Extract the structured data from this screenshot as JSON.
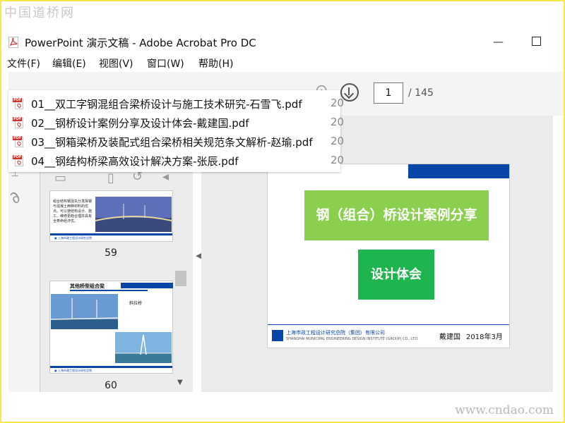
{
  "watermark": {
    "top": "中国道桥网",
    "bottom": "www.cndao.com"
  },
  "window": {
    "title": "PowerPoint 演示文稿 - Adobe Acrobat Pro DC"
  },
  "menu": [
    "文件(F)",
    "编辑(E)",
    "视图(V)",
    "窗口(W)",
    "帮助(H)"
  ],
  "toolbar": {
    "page_current": "1",
    "page_total": "/ 145"
  },
  "recent_files": [
    {
      "name": "01__双工字钢混组合梁桥设计与施工技术研究-石雪飞.pdf",
      "date": "20"
    },
    {
      "name": "02__钢桥设计案例分享及设计体会-戴建国.pdf",
      "date": "20"
    },
    {
      "name": "03__钢箱梁桥及装配式组合梁桥相关规范条文解析-赵瑜.pdf",
      "date": "20"
    },
    {
      "name": "04__钢结构桥梁高效设计解决方案-张辰.pdf",
      "date": "20"
    }
  ],
  "thumbnails": [
    {
      "page": "59",
      "text": "组合结构钢混充分发挥钢与混凝土两种材料的优点。可以使结构设计、施工、维修更趋合理并具有全寿命经济优。"
    },
    {
      "page": "60",
      "title": "其他桥型组合梁",
      "label": "斜拉桥"
    }
  ],
  "slide": {
    "title": "钢（组合）桥设计案例分享",
    "subtitle": "设计体会",
    "org": "上海市政工程设计研究总院（集团）有限公司",
    "author": "戴建国",
    "date": "2018年3月"
  },
  "colors": {
    "slide_blue": "#0a46a8",
    "title_green": "#8bcf4f",
    "subtitle_green": "#1fb54e",
    "page_border_yellow": "#f4e84a"
  }
}
